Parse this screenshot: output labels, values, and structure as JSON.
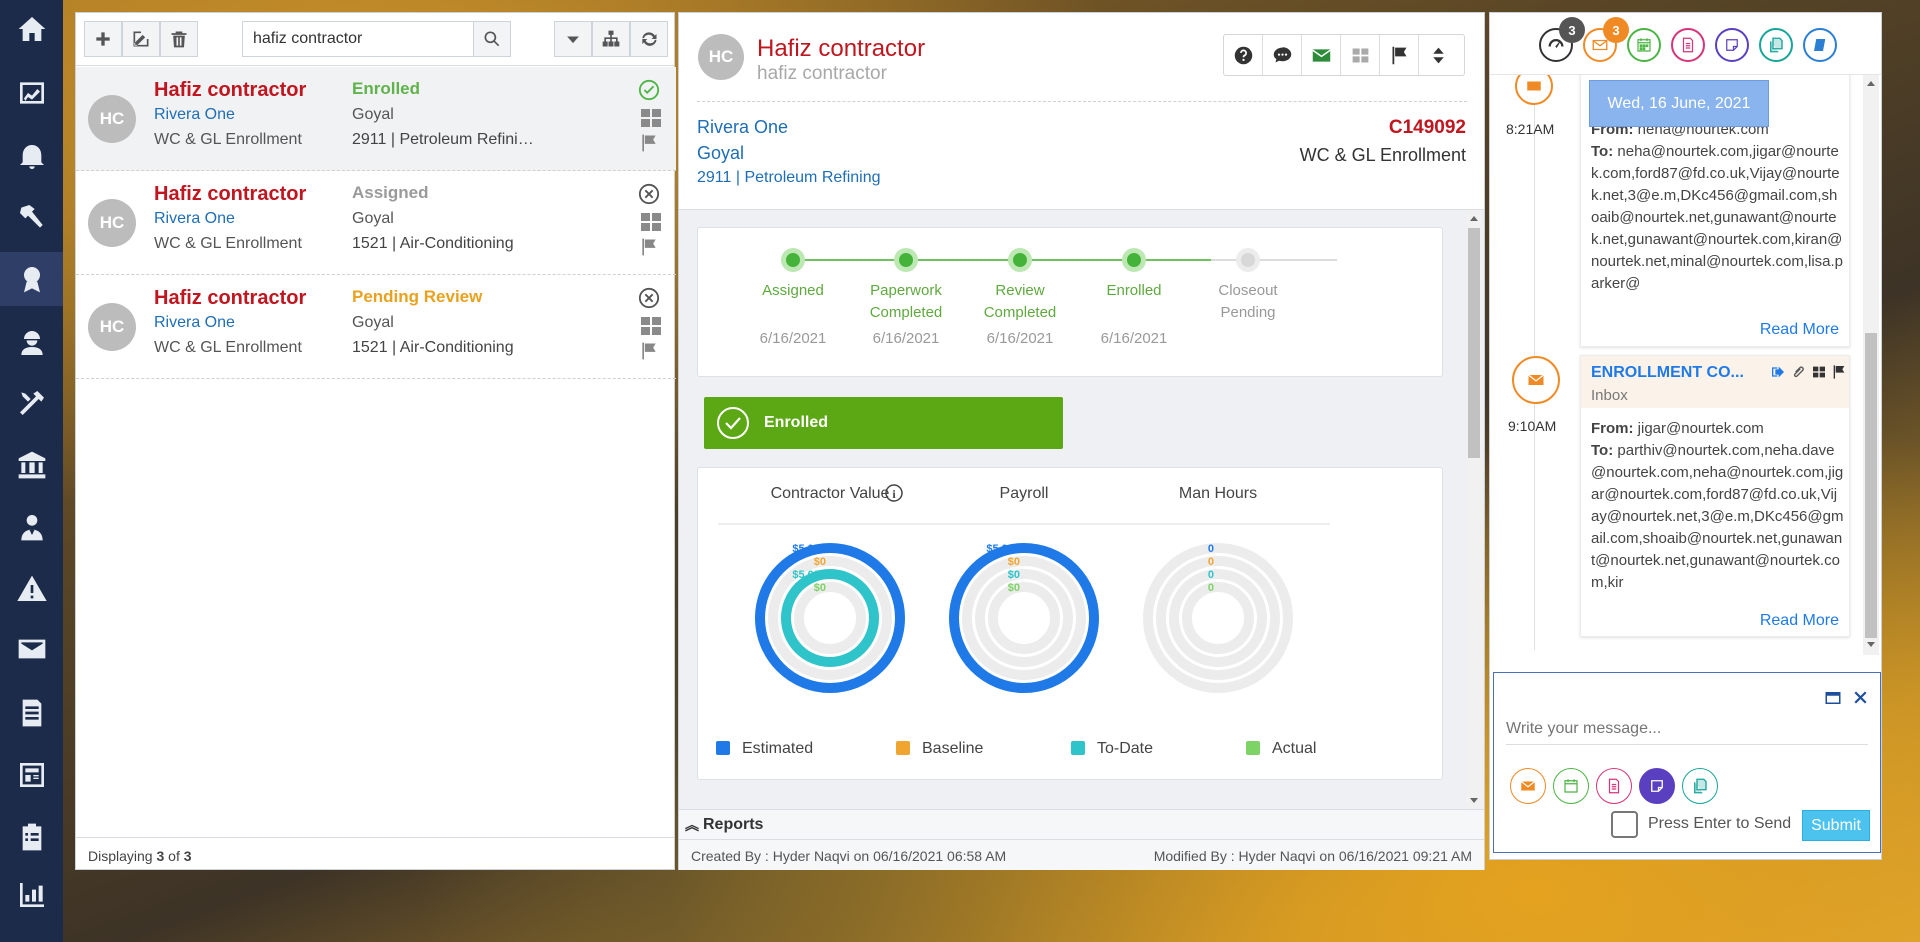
{
  "nav": {
    "items": [
      "home-icon",
      "dashboard-icon",
      "bell-icon",
      "hammer-icon",
      "award-icon",
      "worker-icon",
      "tools-icon",
      "bank-icon",
      "agent-icon",
      "warning-icon",
      "mail-icon",
      "document-icon",
      "newspaper-icon",
      "clipboard-icon",
      "chart-icon"
    ],
    "active": "award-icon"
  },
  "list": {
    "search_value": "hafiz contractor",
    "footer_prefix": "Displaying ",
    "footer_count": "3",
    "footer_of": " of ",
    "footer_total": "3",
    "items": [
      {
        "initials": "HC",
        "name": "Hafiz contractor",
        "company": "Rivera One",
        "type": "WC & GL Enrollment",
        "status": "Enrolled",
        "status_color": "#5fb34a",
        "owner": "Goyal",
        "class": "2911 | Petroleum Refini…",
        "status_icon": "check-circle-icon"
      },
      {
        "initials": "HC",
        "name": "Hafiz contractor",
        "company": "Rivera One",
        "type": "WC & GL Enrollment",
        "status": "Assigned",
        "status_color": "#9a9a9a",
        "owner": "Goyal",
        "class": "1521 | Air-Conditioning",
        "status_icon": "x-circle-icon"
      },
      {
        "initials": "HC",
        "name": "Hafiz contractor",
        "company": "Rivera One",
        "type": "WC & GL Enrollment",
        "status": "Pending Review",
        "status_color": "#e9a21f",
        "owner": "Goyal",
        "class": "1521 | Air-Conditioning",
        "status_icon": "x-circle-icon"
      }
    ]
  },
  "detail": {
    "initials": "HC",
    "title": "Hafiz contractor",
    "subtitle": "hafiz contractor",
    "company": "Rivera One",
    "owner": "Goyal",
    "classification": "2911 | Petroleum Refining",
    "code": "C149092",
    "enrollment_type": "WC & GL Enrollment",
    "steps": [
      {
        "label1": "Assigned",
        "label2": "",
        "date": "6/16/2021",
        "done": true
      },
      {
        "label1": "Paperwork",
        "label2": "Completed",
        "date": "6/16/2021",
        "done": true
      },
      {
        "label1": "Review",
        "label2": "Completed",
        "date": "6/16/2021",
        "done": true
      },
      {
        "label1": "Enrolled",
        "label2": "",
        "date": "6/16/2021",
        "done": true
      },
      {
        "label1": "Closeout",
        "label2": "Pending",
        "date": "",
        "done": false
      }
    ],
    "status_banner": "Enrolled",
    "reports_label": "Reports",
    "created": "Created By : Hyder Naqvi on 06/16/2021 06:58 AM",
    "modified": "Modified By : Hyder Naqvi on 06/16/2021 09:21 AM"
  },
  "chart_data": [
    {
      "type": "radial-bar",
      "title": "Contractor Value",
      "series": [
        {
          "name": "Estimated",
          "value": 5000,
          "label": "$5,000"
        },
        {
          "name": "Baseline",
          "value": 0,
          "label": "$0"
        },
        {
          "name": "To-Date",
          "value": 5000,
          "label": "$5,000"
        },
        {
          "name": "Actual",
          "value": 0,
          "label": "$0"
        }
      ]
    },
    {
      "type": "radial-bar",
      "title": "Payroll",
      "series": [
        {
          "name": "Estimated",
          "value": 5000,
          "label": "$5,000"
        },
        {
          "name": "Baseline",
          "value": 0,
          "label": "$0"
        },
        {
          "name": "To-Date",
          "value": 0,
          "label": "$0"
        },
        {
          "name": "Actual",
          "value": 0,
          "label": "$0"
        }
      ]
    },
    {
      "type": "radial-bar",
      "title": "Man Hours",
      "series": [
        {
          "name": "Estimated",
          "value": 0,
          "label": "0"
        },
        {
          "name": "Baseline",
          "value": 0,
          "label": "0"
        },
        {
          "name": "To-Date",
          "value": 0,
          "label": "0"
        },
        {
          "name": "Actual",
          "value": 0,
          "label": "0"
        }
      ]
    }
  ],
  "legend": [
    {
      "name": "Estimated",
      "color": "#1f7ae8"
    },
    {
      "name": "Baseline",
      "color": "#f1a531"
    },
    {
      "name": "To-Date",
      "color": "#2ec4c9"
    },
    {
      "name": "Actual",
      "color": "#7dd366"
    }
  ],
  "colors": {
    "estimated": "#1f7ae8",
    "baseline": "#f1a531",
    "todate": "#2ec4c9",
    "actual": "#7dd366"
  },
  "feed": {
    "badge_dashboard": "3",
    "badge_mail": "3",
    "date_tooltip": "Wed, 16 June, 2021",
    "entries": [
      {
        "time": "8:21AM",
        "from_label": "From:",
        "from": "neha@nourtek.com",
        "to_label": "To:",
        "to": "neha@nourtek.com,jigar@nourtek.com,ford87@fd.co.uk,Vijay@nourtek.net,3@e.m,DKc456@gmail.com,shoaib@nourtek.net,gunawant@nourtek.net,gunawant@nourtek.com,kiran@nourtek.net,minal@nourtek.com,lisa.parker@",
        "read_more": "Read More"
      },
      {
        "time": "9:10AM",
        "subject": "ENROLLMENT CO...",
        "folder": "Inbox",
        "from_label": "From:",
        "from": "jigar@nourtek.com",
        "to_label": "To:",
        "to": "parthiv@nourtek.com,neha.dave@nourtek.com,neha@nourtek.com,jigar@nourtek.com,ford87@fd.co.uk,Vijay@nourtek.net,3@e.m,DKc456@gmail.com,shoaib@nourtek.net,gunawant@nourtek.net,gunawant@nourtek.com,kir",
        "read_more": "Read More"
      }
    ],
    "composer_placeholder": "Write your message...",
    "enter_label": "Press Enter to Send",
    "submit": "Submit"
  }
}
